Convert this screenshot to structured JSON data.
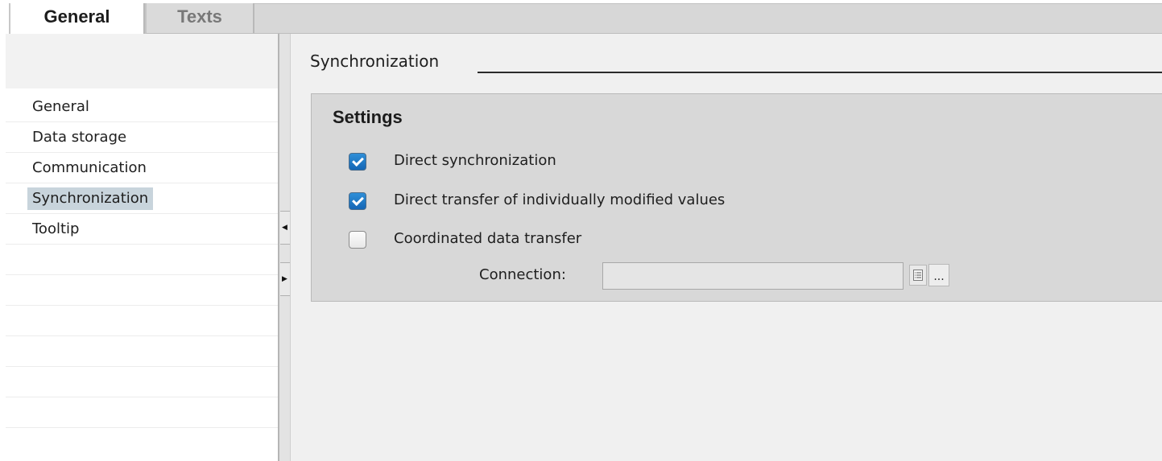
{
  "tabs": [
    {
      "label": "General",
      "active": true
    },
    {
      "label": "Texts",
      "active": false
    }
  ],
  "nav": {
    "items": [
      {
        "label": "General"
      },
      {
        "label": "Data storage"
      },
      {
        "label": "Communication"
      },
      {
        "label": "Synchronization",
        "active": true
      },
      {
        "label": "Tooltip"
      }
    ]
  },
  "splitter": {
    "collapse_icon": "triangle-left-icon",
    "expand_icon": "triangle-right-icon"
  },
  "content": {
    "section_title": "Synchronization",
    "group_title": "Settings",
    "options": [
      {
        "label": "Direct synchronization",
        "checked": true
      },
      {
        "label": "Direct transfer of individually modified values",
        "checked": true
      },
      {
        "label": "Coordinated data transfer",
        "checked": false
      }
    ],
    "connection": {
      "label": "Connection:",
      "value": "",
      "list_icon": "list-icon",
      "more_label": "..."
    }
  },
  "colors": {
    "checkbox_checked": "#1f7acb",
    "nav_selected": "#c8d4dc",
    "group_background": "#d8d8d8",
    "content_background": "#f0f0f0"
  }
}
